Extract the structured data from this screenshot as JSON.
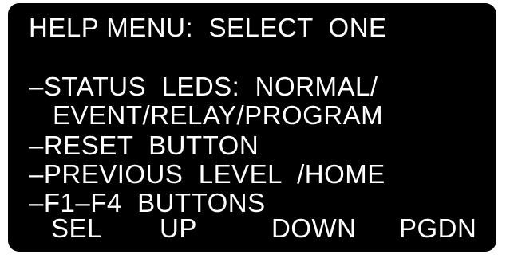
{
  "menu": {
    "title": "HELP MENU:  SELECT  ONE",
    "items": [
      {
        "line1": "–STATUS  LEDS:  NORMAL/",
        "line2": "EVENT/RELAY/PROGRAM"
      },
      {
        "line1": "–RESET  BUTTON"
      },
      {
        "line1": "–PREVIOUS  LEVEL  /HOME"
      },
      {
        "line1": "–F1–F4  BUTTONS"
      }
    ]
  },
  "softkeys": [
    {
      "label": "SEL"
    },
    {
      "label": "UP"
    },
    {
      "label": "DOWN"
    },
    {
      "label": "PGDN"
    }
  ],
  "colors": {
    "background": "#000000",
    "text": "#ffffff"
  }
}
